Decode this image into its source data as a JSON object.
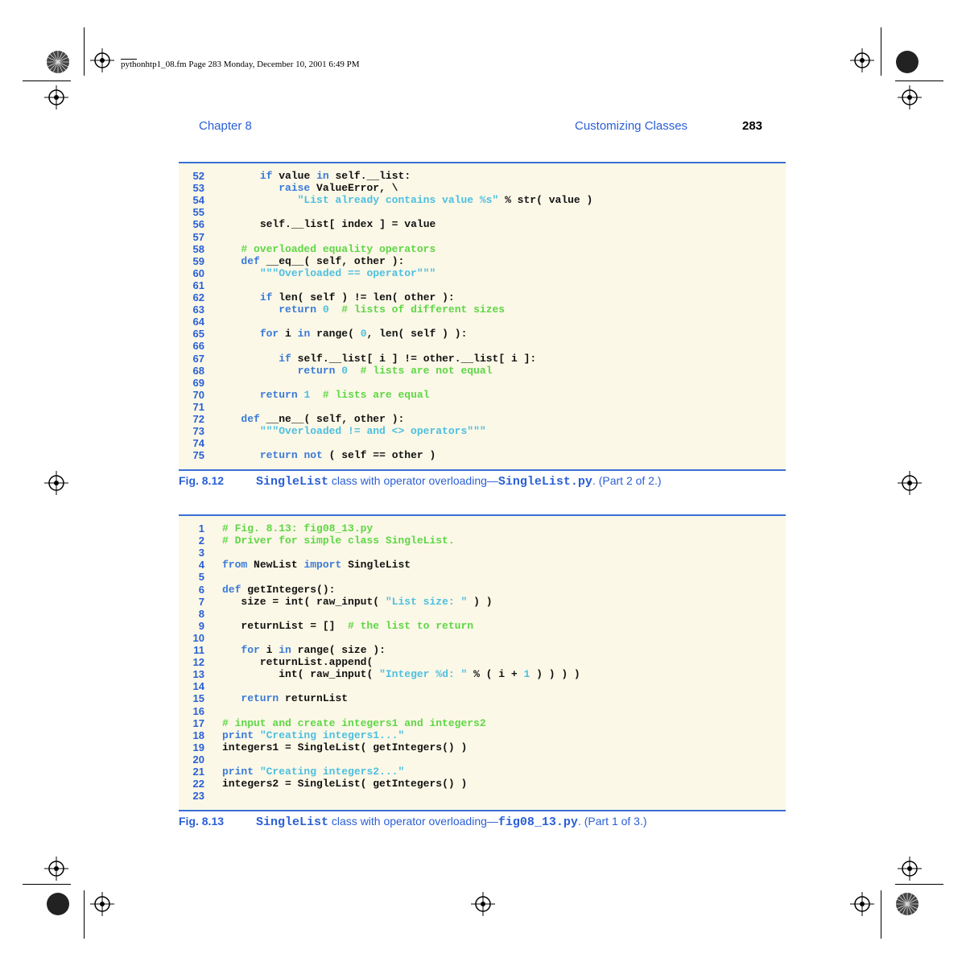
{
  "slug": "pythonhtp1_08.fm  Page 283  Monday, December 10, 2001  6:49 PM",
  "header": {
    "chapter": "Chapter 8",
    "section": "Customizing Classes",
    "page_number": "283"
  },
  "listing1": {
    "lines": [
      {
        "n": "52",
        "code": "      if value in self.__list:"
      },
      {
        "n": "53",
        "code": "         raise ValueError, \\"
      },
      {
        "n": "54",
        "code": "            \"List already contains value %s\" % str( value )"
      },
      {
        "n": "55",
        "code": ""
      },
      {
        "n": "56",
        "code": "      self.__list[ index ] = value"
      },
      {
        "n": "57",
        "code": ""
      },
      {
        "n": "58",
        "code": "   # overloaded equality operators"
      },
      {
        "n": "59",
        "code": "   def __eq__( self, other ):"
      },
      {
        "n": "60",
        "code": "      \"\"\"Overloaded == operator\"\"\""
      },
      {
        "n": "61",
        "code": ""
      },
      {
        "n": "62",
        "code": "      if len( self ) != len( other ):"
      },
      {
        "n": "63",
        "code": "         return 0  # lists of different sizes"
      },
      {
        "n": "64",
        "code": ""
      },
      {
        "n": "65",
        "code": "      for i in range( 0, len( self ) ):"
      },
      {
        "n": "66",
        "code": ""
      },
      {
        "n": "67",
        "code": "         if self.__list[ i ] != other.__list[ i ]:"
      },
      {
        "n": "68",
        "code": "            return 0  # lists are not equal"
      },
      {
        "n": "69",
        "code": ""
      },
      {
        "n": "70",
        "code": "      return 1  # lists are equal"
      },
      {
        "n": "71",
        "code": ""
      },
      {
        "n": "72",
        "code": "   def __ne__( self, other ):"
      },
      {
        "n": "73",
        "code": "      \"\"\"Overloaded != and <> operators\"\"\""
      },
      {
        "n": "74",
        "code": ""
      },
      {
        "n": "75",
        "code": "      return not ( self == other )"
      }
    ]
  },
  "caption1": {
    "fig": "Fig. 8.12",
    "name": "SingleList",
    "text_a": " class with operator overloading—",
    "file": "SingleList.py",
    "text_b": ". (Part 2 of 2.)"
  },
  "listing2": {
    "lines": [
      {
        "n": "1",
        "code": "# Fig. 8.13: fig08_13.py"
      },
      {
        "n": "2",
        "code": "# Driver for simple class SingleList."
      },
      {
        "n": "3",
        "code": ""
      },
      {
        "n": "4",
        "code": "from NewList import SingleList"
      },
      {
        "n": "5",
        "code": ""
      },
      {
        "n": "6",
        "code": "def getIntegers():"
      },
      {
        "n": "7",
        "code": "   size = int( raw_input( \"List size: \" ) )"
      },
      {
        "n": "8",
        "code": ""
      },
      {
        "n": "9",
        "code": "   returnList = []  # the list to return"
      },
      {
        "n": "10",
        "code": ""
      },
      {
        "n": "11",
        "code": "   for i in range( size ):"
      },
      {
        "n": "12",
        "code": "      returnList.append("
      },
      {
        "n": "13",
        "code": "         int( raw_input( \"Integer %d: \" % ( i + 1 ) ) ) )"
      },
      {
        "n": "14",
        "code": ""
      },
      {
        "n": "15",
        "code": "   return returnList"
      },
      {
        "n": "16",
        "code": ""
      },
      {
        "n": "17",
        "code": "# input and create integers1 and integers2"
      },
      {
        "n": "18",
        "code": "print \"Creating integers1...\""
      },
      {
        "n": "19",
        "code": "integers1 = SingleList( getIntegers() )"
      },
      {
        "n": "20",
        "code": ""
      },
      {
        "n": "21",
        "code": "print \"Creating integers2...\""
      },
      {
        "n": "22",
        "code": "integers2 = SingleList( getIntegers() )"
      },
      {
        "n": "23",
        "code": ""
      }
    ]
  },
  "caption2": {
    "fig": "Fig. 8.13",
    "name": "SingleList",
    "text_a": " class with operator overloading—",
    "file": "fig08_13.py",
    "text_b": ". (Part 1 of 3.)"
  }
}
